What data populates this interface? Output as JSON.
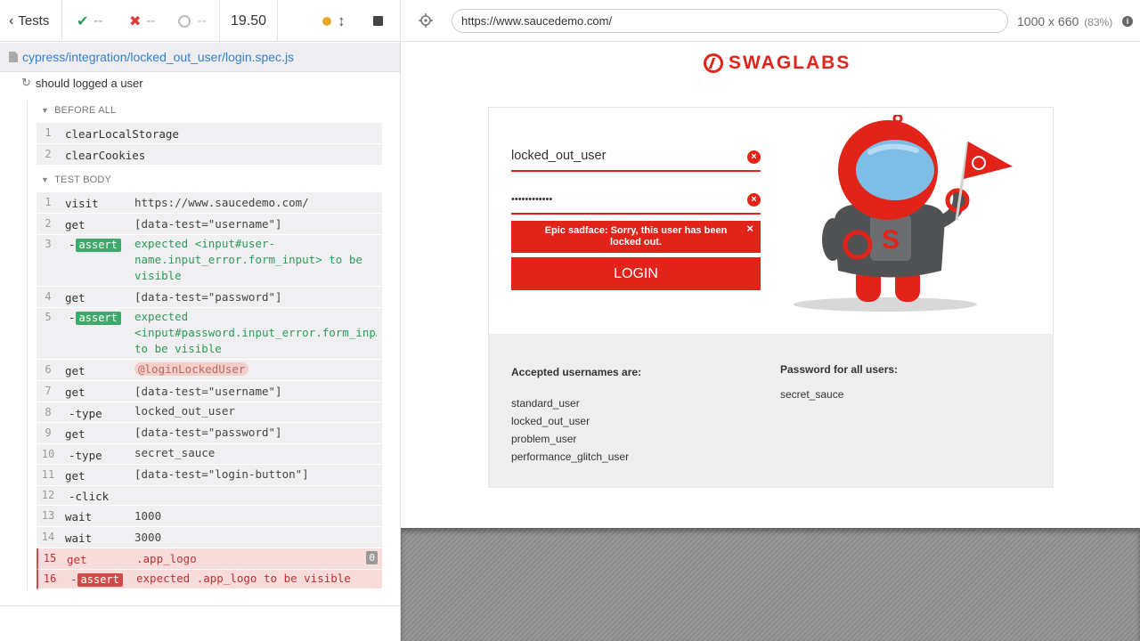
{
  "reporter": {
    "tests_label": "Tests",
    "passed": "--",
    "failed": "--",
    "pending": "--",
    "duration": "19.50",
    "spec_path": "cypress/integration/locked_out_user/login.spec.js",
    "test_title": "should logged a user",
    "before_all_label": "BEFORE ALL",
    "test_body_label": "TEST BODY",
    "before_all": [
      {
        "num": "1",
        "name": "clearLocalStorage",
        "msg": ""
      },
      {
        "num": "2",
        "name": "clearCookies",
        "msg": ""
      }
    ],
    "commands": [
      {
        "num": "1",
        "name": "visit",
        "msg": "https://www.saucedemo.com/"
      },
      {
        "num": "2",
        "name": "get",
        "msg": "[data-test=\"username\"]"
      },
      {
        "num": "3",
        "name": "-",
        "badge": "assert",
        "msg_line1": "expected  <input#user-",
        "msg_line2": "name.input_error.form_input>  to be",
        "msg_line3": "visible"
      },
      {
        "num": "4",
        "name": "get",
        "msg": "[data-test=\"password\"]"
      },
      {
        "num": "5",
        "name": "-",
        "badge": "assert",
        "msg_line1": "expected",
        "msg_line2": "<input#password.input_error.form_inp…",
        "msg_line3": "to be  visible"
      },
      {
        "num": "6",
        "name": "get",
        "alias": "@loginLockedUser"
      },
      {
        "num": "7",
        "name": "get",
        "msg": "[data-test=\"username\"]"
      },
      {
        "num": "8",
        "name": "-type",
        "msg": "locked_out_user"
      },
      {
        "num": "9",
        "name": "get",
        "msg": "[data-test=\"password\"]"
      },
      {
        "num": "10",
        "name": "-type",
        "msg": "secret_sauce"
      },
      {
        "num": "11",
        "name": "get",
        "msg": "[data-test=\"login-button\"]"
      },
      {
        "num": "12",
        "name": "-click",
        "msg": ""
      },
      {
        "num": "13",
        "name": "wait",
        "msg": "1000"
      },
      {
        "num": "14",
        "name": "wait",
        "msg": "3000"
      },
      {
        "num": "15",
        "name": "get",
        "msg": ".app_logo",
        "count": "0"
      },
      {
        "num": "16",
        "name": "-",
        "badge": "assert",
        "msg": "expected  .app_logo  to be  visible"
      }
    ]
  },
  "aut": {
    "url": "https://www.saucedemo.com/",
    "viewport": "1000 x 660",
    "scale": "(83%)",
    "info_icon": "i"
  },
  "page": {
    "logo_text": "SWAGLABS",
    "username_value": "locked_out_user",
    "password_value": "••••••••••••",
    "error_message": "Epic sadface: Sorry, this user has been locked out.",
    "error_close": "×",
    "login_button": "LOGIN",
    "accepted_title": "Accepted usernames are:",
    "usernames": [
      "standard_user",
      "locked_out_user",
      "problem_user",
      "performance_glitch_user"
    ],
    "password_title": "Password for all users:",
    "password_hint": "secret_sauce"
  },
  "colors": {
    "brand_red": "#e2231a",
    "pass_green": "#3daa6a",
    "fail_red": "#d34a4a",
    "url_blue": "#3380d0"
  },
  "icons": {
    "back": "chevron-left-icon",
    "passed": "check-icon",
    "failed": "x-icon",
    "pending": "circle-icon",
    "status": "dot-icon",
    "scroll": "arrows-vertical-icon",
    "stop": "stop-icon",
    "selector": "crosshair-icon",
    "file": "file-icon",
    "retry": "refresh-icon"
  }
}
